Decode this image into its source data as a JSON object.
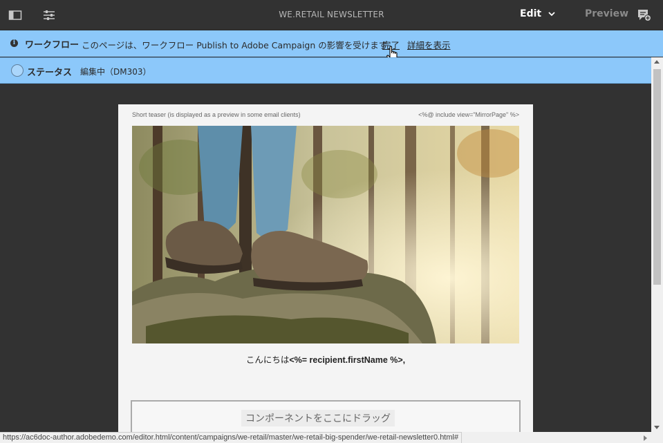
{
  "topbar": {
    "title": "WE.RETAIL NEWSLETTER",
    "mode_label": "Edit",
    "preview_label": "Preview",
    "icons": [
      "side-panel-icon",
      "properties-icon",
      "chevron-down-icon",
      "annotate-icon"
    ]
  },
  "workflow": {
    "info_icon": "info-icon",
    "title": "ワークフロー",
    "message": "このページは、ワークフロー Publish to Adobe Campaign の影響を受けます",
    "complete_link": "完了",
    "details_link": "詳細を表示"
  },
  "status": {
    "title": "ステータス",
    "value": "編集中（DM303）"
  },
  "email": {
    "teaser": "Short teaser (is displayed as a preview in some email clients)",
    "mirror": "<%@ include view=\"MirrorPage\" %>",
    "greeting_prefix": "こんにちは",
    "greeting_field": "<%= recipient.firstName %>,",
    "dropzone_label": "コンポーネントをここにドラッグ"
  },
  "browser": {
    "status_url": "https://ac6doc-author.adobedemo.com/editor.html/content/campaigns/we-retail/master/we-retail-big-spender/we-retail-newsletter0.html#"
  },
  "colors": {
    "chrome_bg": "#323232",
    "info_bar_bg": "#8cc8fa",
    "canvas_bg": "#f4f4f4"
  }
}
